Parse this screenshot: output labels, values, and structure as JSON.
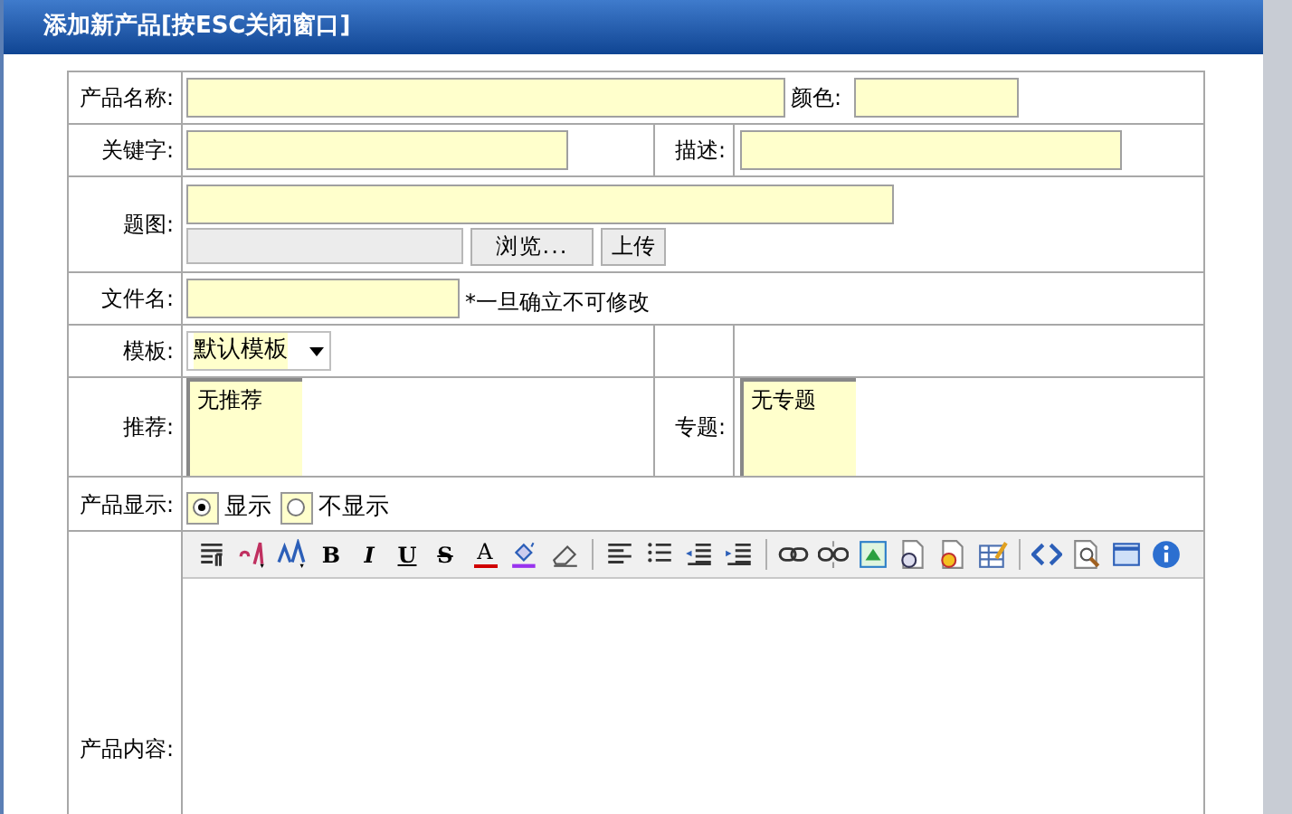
{
  "window": {
    "title": "添加新产品[按ESC关闭窗口]"
  },
  "form": {
    "name": {
      "label": "产品名称:"
    },
    "color": {
      "label": "颜色:"
    },
    "keywords": {
      "label": "关键字:"
    },
    "description": {
      "label": "描述:"
    },
    "title_image": {
      "label": "题图:",
      "browse_button": "浏览...",
      "upload_button": "上传"
    },
    "file_name": {
      "label": "文件名:",
      "note": "*一旦确立不可修改"
    },
    "template": {
      "label": "模板:",
      "value": "默认模板"
    },
    "recommend": {
      "label": "推荐:",
      "options": [
        "无推荐"
      ]
    },
    "topic": {
      "label": "专题:",
      "options": [
        "无专题"
      ]
    },
    "display": {
      "label": "产品显示:",
      "options": [
        {
          "label": "显示",
          "selected": true
        },
        {
          "label": "不显示",
          "selected": false
        }
      ]
    },
    "content": {
      "label": "产品内容:"
    }
  },
  "editor_toolbar": {
    "format_buttons": [
      {
        "kind": "bold",
        "label": "B"
      },
      {
        "kind": "italic",
        "label": "I"
      },
      {
        "kind": "underline",
        "label": "U"
      },
      {
        "kind": "strike",
        "label": "S"
      },
      {
        "kind": "text-color",
        "label": "A"
      }
    ]
  }
}
